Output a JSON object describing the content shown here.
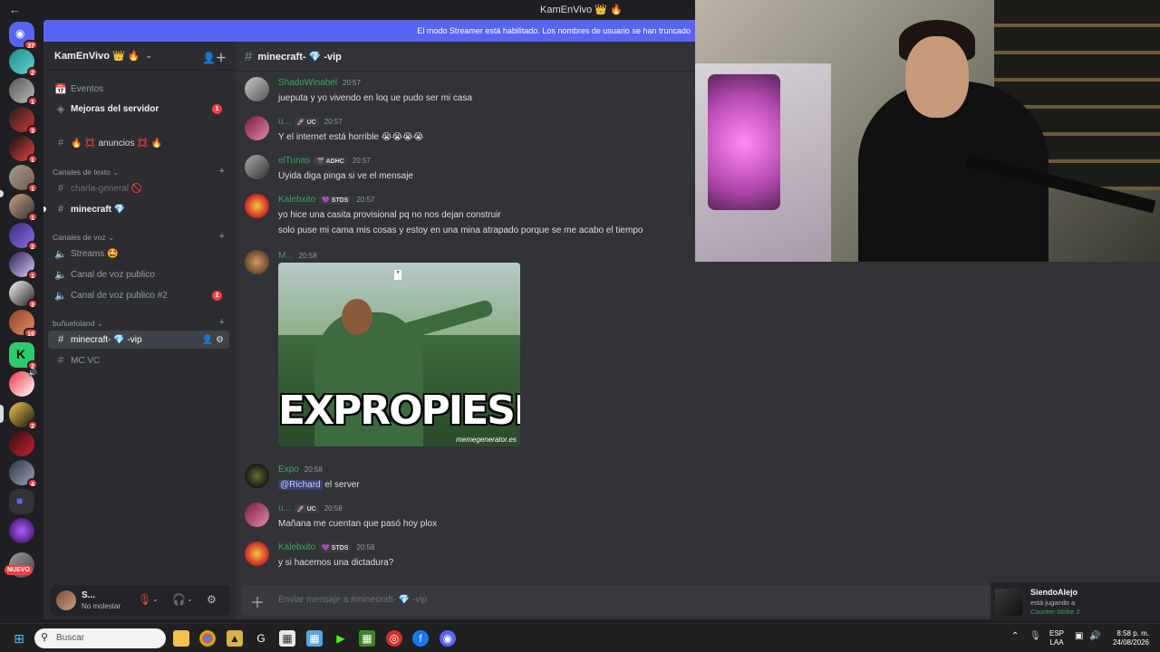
{
  "titlebar": {
    "back_icon": "arrow-left-icon",
    "title": "KamEnVivo 👑 🔥"
  },
  "banner": {
    "text": "El modo Streamer está habilitado. Los nombres de usuario se han truncado"
  },
  "rail": {
    "badges": [
      "37",
      "2",
      "1",
      "3",
      "1",
      "1",
      "1",
      "2",
      "1",
      "3",
      "16",
      "2",
      "",
      "2",
      "",
      "4"
    ],
    "new_label": "NUEVO"
  },
  "server": {
    "name": "KamEnVivo 👑 🔥"
  },
  "sidebar": {
    "events": "Eventos",
    "boosts": "Mejoras del servidor",
    "boosts_badge": "1",
    "announce": "🔥 💢 anuncios 💢 🔥",
    "cat_text": "Canales de texto",
    "ch_general": "charla-general 🚫",
    "ch_minecraft": "minecraft 💎",
    "cat_voice": "Canales de voz",
    "vc_streams": "Streams 🤩",
    "vc_public": "Canal de voz publico",
    "vc_public2": "Canal de voz publico #2",
    "vc_public2_badge": "2",
    "cat_bunuelo": "buñueloland",
    "ch_vip": "minecraft- 💎 -vip",
    "vc_mc": "MC VC"
  },
  "user": {
    "name": "S...",
    "status": "No molestar"
  },
  "chat": {
    "channel": "minecraft- 💎 -vip",
    "messages": [
      {
        "name": "ShadoWinabel",
        "tag": "",
        "time": "20:57",
        "text": "jueputa y yo vivendo en loq ue pudo ser mi casa"
      },
      {
        "name": "u...",
        "tag": "🚀 UC",
        "time": "20:57",
        "text": "Y el internet está horrible 😭😭😭😭"
      },
      {
        "name": "elTunas",
        "tag": "🎬 ADHC",
        "time": "20:57",
        "text": "Uyida diga pinga si ve el mensaje"
      },
      {
        "name": "Kalebxito",
        "tag": "💜 STDS",
        "time": "20:57",
        "text": "yo hice una casita provisional pq no nos dejan construir",
        "text2": "solo puse mi cama mis cosas y estoy en una mina atrapado porque se me acabo el tiempo"
      },
      {
        "name": "M...",
        "tag": "",
        "time": "20:58",
        "text": ""
      },
      {
        "name": "Expo",
        "tag": "",
        "time": "20:58",
        "mention": "@Richard",
        "text": " el server"
      },
      {
        "name": "u...",
        "tag": "🚀 UC",
        "time": "20:58",
        "text": "Mañana me cuentan que pasó hoy plox"
      },
      {
        "name": "Kalebxito",
        "tag": "💜 STDS",
        "time": "20:58",
        "text": "y si hacemos una dictadura?"
      }
    ],
    "meme": {
      "caption": "EXPROPIESE",
      "watermark": "memegenerator.es",
      "quote": "'"
    },
    "composer_placeholder": "Enviar mensaje a #minecraft- 💎 -vip"
  },
  "activity": {
    "user": "SiendoAlejo",
    "doing": "está jugando a",
    "game": "Counter-Strike 2"
  },
  "taskbar": {
    "search": "Buscar",
    "lang1": "ESP",
    "lang2": "LAA",
    "time": "8:58 p. m.",
    "date": "24/08/2026"
  }
}
